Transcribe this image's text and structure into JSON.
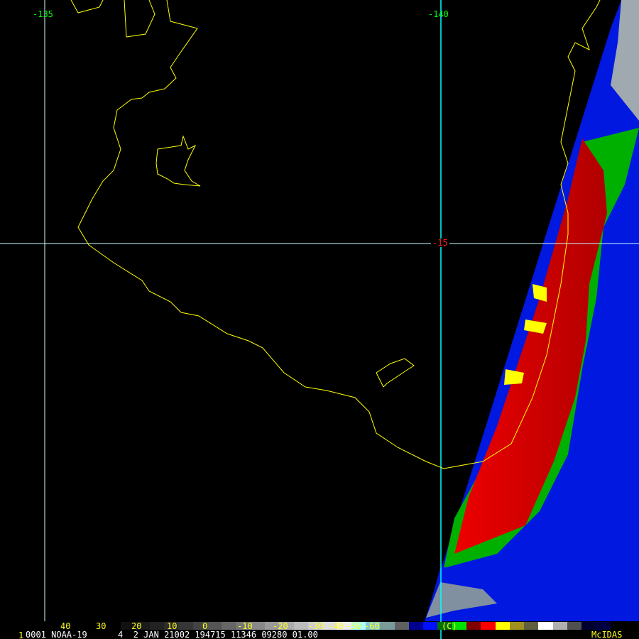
{
  "grid_labels": {
    "lon_left": "-135",
    "lon_right": "-140",
    "lat": "-15"
  },
  "colorbar": {
    "ticks": [
      "40",
      "30",
      "20",
      "10",
      "0",
      "-10",
      "-20",
      "-30",
      "-40",
      "-50",
      "-60"
    ],
    "marker": "(C)"
  },
  "info": {
    "frame": "1",
    "line": "0001 NOAA-19      4  2 JAN 21002 194715 11346 09280 01.00"
  },
  "logo": "McIDAS",
  "colors": {
    "coast": "#ffff00",
    "grid": "#00ffff",
    "cloud_red": "#ff0000",
    "cloud_green": "#00b000",
    "cloud_blue": "#0010e0"
  }
}
